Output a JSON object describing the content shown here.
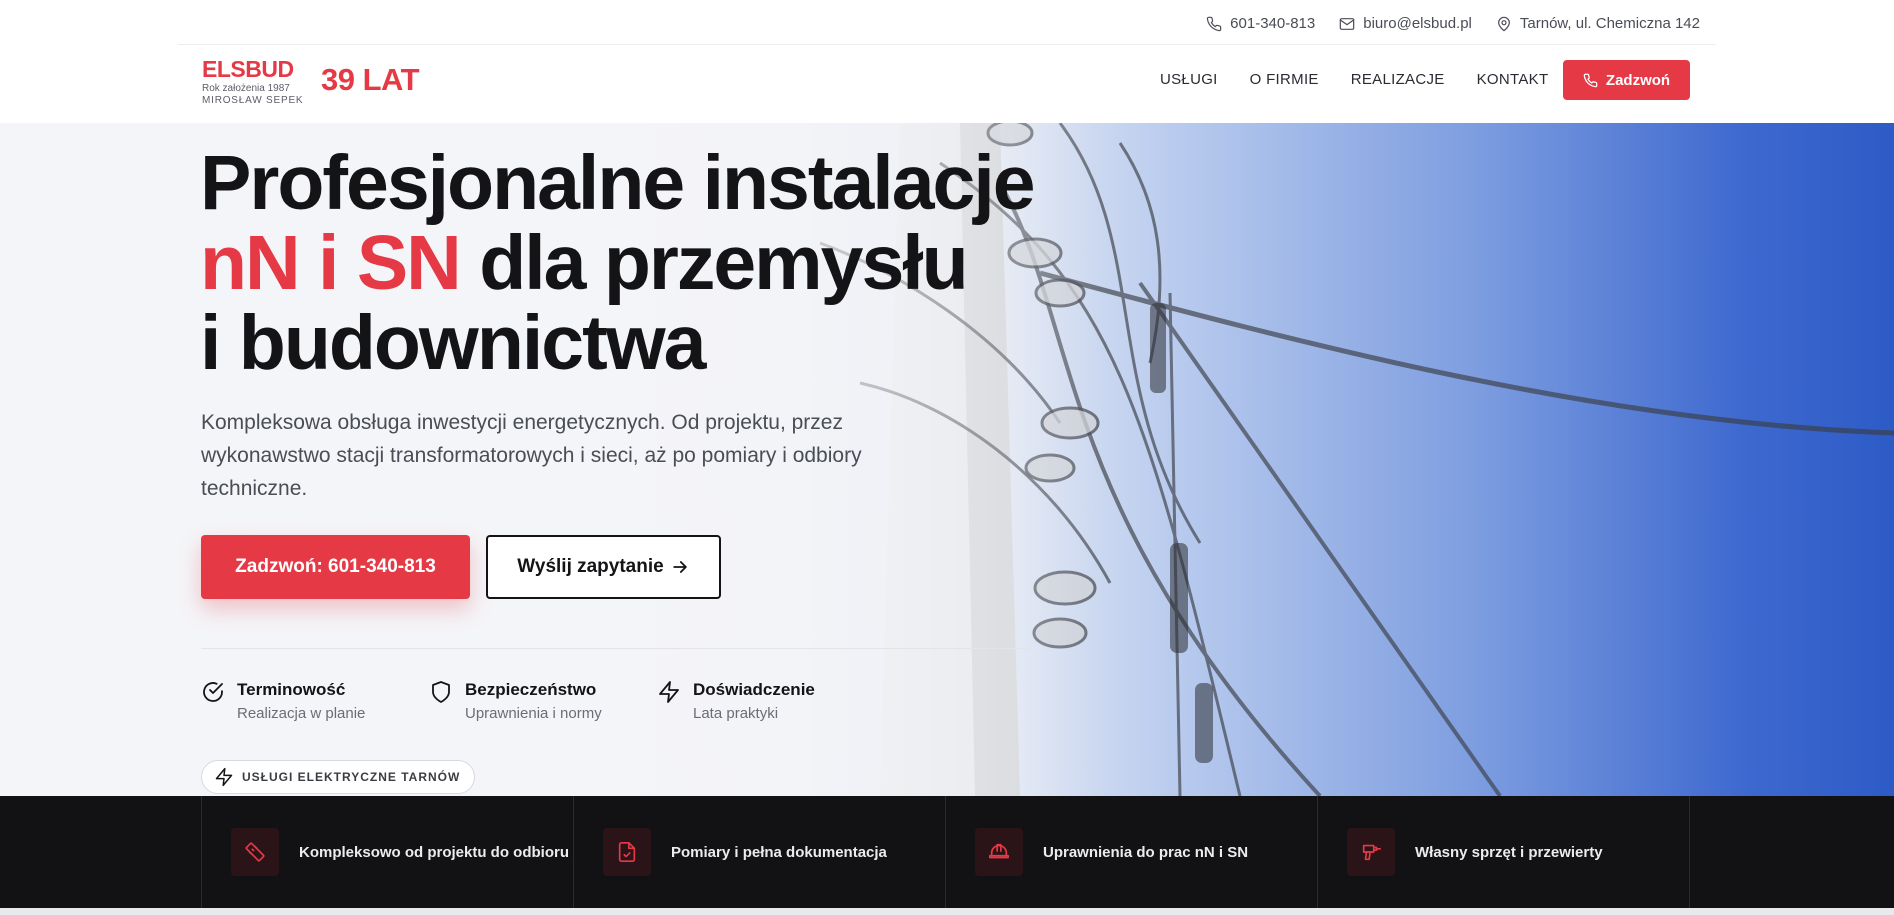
{
  "topbar": {
    "phone": "601-340-813",
    "email": "biuro@elsbud.pl",
    "address": "Tarnów, ul. Chemiczna 142"
  },
  "header": {
    "logo_name": "ELSBUD",
    "logo_founded": "Rok założenia 1987",
    "logo_owner": "MIROSŁAW SEPEK",
    "years_badge": "39 LAT",
    "nav": [
      "USŁUGI",
      "O FIRMIE",
      "REALIZACJE",
      "KONTAKT"
    ],
    "call_label": "Zadzwoń"
  },
  "hero": {
    "headline_line1": "Profesjonalne instalacje",
    "headline_accent": "nN i SN",
    "headline_line2_rest": " dla przemysłu",
    "headline_line3": "i budownictwa",
    "lead": "Kompleksowa obsługa inwestycji energetycznych. Od projektu, przez wykonawstwo stacji transformatorowych i sieci, aż po pomiary i odbiory techniczne.",
    "primary_button": "Zadzwoń: 601-340-813",
    "secondary_button": "Wyślij zapytanie",
    "features": [
      {
        "title": "Terminowość",
        "subtitle": "Realizacja w planie",
        "icon": "check-circle-icon"
      },
      {
        "title": "Bezpieczeństwo",
        "subtitle": "Uprawnienia i normy",
        "icon": "shield-icon"
      },
      {
        "title": "Doświadczenie",
        "subtitle": "Lata praktyki",
        "icon": "lightning-icon"
      }
    ],
    "tag": "USŁUGI ELEKTRYCZNE TARNÓW"
  },
  "strip": [
    {
      "label": "Kompleksowo od projektu do odbioru",
      "icon": "ruler-icon"
    },
    {
      "label": "Pomiary i pełna dokumentacja",
      "icon": "document-check-icon"
    },
    {
      "label": "Uprawnienia do prac nN i SN",
      "icon": "hard-hat-icon"
    },
    {
      "label": "Własny sprzęt i przewierty",
      "icon": "drill-icon"
    }
  ],
  "colors": {
    "accent": "#e63946",
    "dark": "#141416",
    "strip_bg": "#121214",
    "sky": "#2d5bc6"
  }
}
